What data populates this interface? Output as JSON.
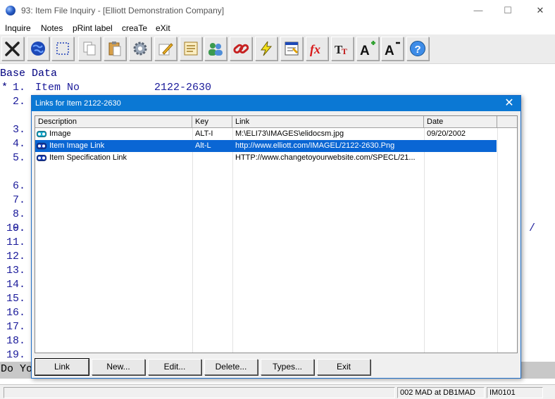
{
  "window": {
    "title": "93: Item File Inquiry - [Elliott Demonstration Company]",
    "min_glyph": "—",
    "max_glyph": "☐",
    "close_glyph": "✕"
  },
  "menu": [
    "Inquire",
    "Notes",
    "pRint label",
    "creaTe",
    "eXit"
  ],
  "toolbar": {
    "icons": [
      "exit-icon",
      "globe-icon",
      "select-icon",
      "copy-icon",
      "paste-icon",
      "settings-icon",
      "edit-icon",
      "notes-icon",
      "users-icon",
      "link-icon",
      "lightning-icon",
      "screen-icon",
      "function-icon",
      "font-icon",
      "font-increase-icon",
      "font-decrease-icon",
      "help-icon"
    ]
  },
  "screen": {
    "section_title": "Base Data",
    "item_marker": "*",
    "line_numbers": [
      "1.",
      "2.",
      "3.",
      "4.",
      "5.",
      "6.",
      "7.",
      "8.",
      "9.",
      "10.",
      "11.",
      "12.",
      "13.",
      "14.",
      "15.",
      "16.",
      "17.",
      "18.",
      "19."
    ],
    "item_no_label": "Item No",
    "item_no_value": "2122-2630",
    "line10_suffix": "/",
    "prompt_text": "Do Yo"
  },
  "status": {
    "left": "",
    "location": "002 MAD at DB1MAD",
    "screen_id": "IM0101"
  },
  "dialog": {
    "title": "Links for Item 2122-2630",
    "close_glyph": "✕",
    "columns": [
      "Description",
      "Key",
      "Link",
      "Date"
    ],
    "rows": [
      {
        "description": "Image",
        "key": "ALT-I",
        "link": "M:\\ELI73\\IMAGES\\elidocsm.jpg",
        "date": "09/20/2002",
        "selected": false
      },
      {
        "description": "Item Image Link",
        "key": "Alt-L",
        "link": "http://www.elliott.com/IMAGEL/2122-2630.Png",
        "date": "",
        "selected": true
      },
      {
        "description": "Item Specification Link",
        "key": "",
        "link": "HTTP://www.changetoyourwebsite.com/SPECL/21...",
        "date": "",
        "selected": false
      }
    ],
    "buttons": [
      "Link",
      "New...",
      "Edit...",
      "Delete...",
      "Types...",
      "Exit"
    ]
  },
  "colors": {
    "accent": "#0b78d4",
    "selection": "#0a66d4",
    "screen_text": "#1a1a9a",
    "link_icon_primary": "#1a3fb3",
    "link_icon_special": "#18a7c9"
  }
}
